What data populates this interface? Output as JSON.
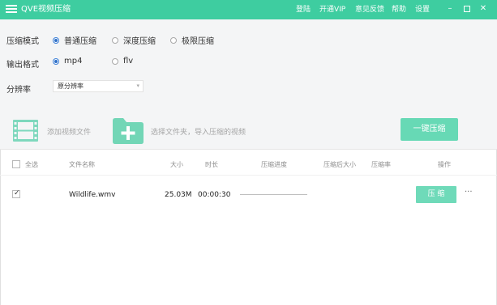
{
  "titlebar": {
    "title": "QVE视频压缩",
    "links": [
      "登陆",
      "开通VIP",
      "意见反馈",
      "帮助",
      "设置"
    ],
    "window_buttons": [
      "minimize-icon",
      "maximize-icon",
      "close-icon"
    ],
    "bg_color": "#3ecda0"
  },
  "settings": {
    "mode_label": "压缩模式",
    "mode_options": [
      {
        "label": "普通压缩",
        "selected": true
      },
      {
        "label": "深度压缩",
        "selected": false
      },
      {
        "label": "极限压缩",
        "selected": false
      }
    ],
    "format_label": "输出格式",
    "format_options": [
      {
        "label": "mp4",
        "selected": true
      },
      {
        "label": "flv",
        "selected": false
      }
    ],
    "resolution_label": "分辨率",
    "resolution_value": "原分辨率"
  },
  "actions": {
    "add_video": "添加视频文件",
    "add_folder": "选择文件夹，导入压缩的视频",
    "one_click": "一键压缩",
    "accent": "#67d9b5"
  },
  "table": {
    "select_all": "全选",
    "headers": [
      "文件名称",
      "大小",
      "时长",
      "压缩进度",
      "压缩后大小",
      "压缩率",
      "操作"
    ],
    "rows": [
      {
        "checked": true,
        "name": "Wildlife.wmv",
        "size": "25.03M",
        "duration": "00:00:30",
        "progress": 0,
        "compressed_size": "",
        "ratio": "",
        "action": "压 缩",
        "more": "···"
      }
    ]
  }
}
